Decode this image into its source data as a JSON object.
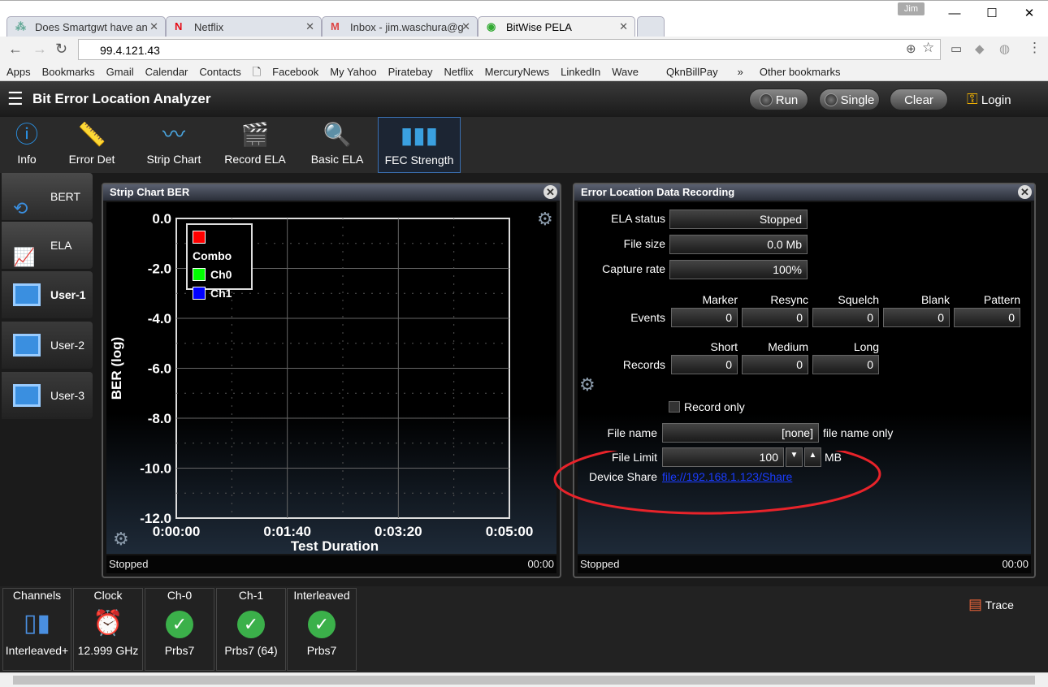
{
  "browser": {
    "tabs": [
      {
        "title": "Does Smartgwt have an",
        "icon": "smartgwt-icon"
      },
      {
        "title": "Netflix",
        "icon": "netflix-icon"
      },
      {
        "title": "Inbox - jim.waschura@g",
        "icon": "gmail-icon"
      },
      {
        "title": "BitWise PELA",
        "icon": "owl-icon",
        "active": true
      }
    ],
    "user": "Jim",
    "url": "99.4.121.43",
    "bookmarks": [
      "Apps",
      "Bookmarks",
      "Gmail",
      "Calendar",
      "Contacts",
      "",
      "Facebook",
      "My Yahoo",
      "Piratebay",
      "Netflix",
      "MercuryNews",
      "LinkedIn",
      "Wave",
      "QknBillPay",
      "»"
    ],
    "other_bookmarks": "Other bookmarks"
  },
  "app": {
    "title": "Bit Error Location Analyzer",
    "buttons": {
      "run": "Run",
      "single": "Single",
      "clear": "Clear",
      "login": "Login"
    },
    "toolbar": [
      {
        "label": "Info",
        "icon": "info-icon"
      },
      {
        "label": "Error Det",
        "icon": "ruler-icon"
      },
      {
        "label": "Strip Chart",
        "icon": "strip-chart-icon"
      },
      {
        "label": "Record ELA",
        "icon": "clapper-icon"
      },
      {
        "label": "Basic ELA",
        "icon": "document-search-icon"
      },
      {
        "label": "FEC Strength",
        "icon": "bar-chart-icon",
        "selected": true
      }
    ],
    "sidebar": [
      {
        "label": "BERT"
      },
      {
        "label": "ELA"
      },
      {
        "label": "User-1",
        "selected": true
      },
      {
        "label": "User-2"
      },
      {
        "label": "User-3"
      }
    ]
  },
  "strip_panel": {
    "title": "Strip Chart BER",
    "status": "Stopped",
    "time": "00:00",
    "chart": {
      "ylabel": "BER (log)",
      "xlabel": "Test Duration",
      "yticks": [
        "0.0",
        "-2.0",
        "-4.0",
        "-6.0",
        "-8.0",
        "-10.0",
        "-12.0"
      ],
      "xticks": [
        "0:00:00",
        "0:01:40",
        "0:03:20",
        "0:05:00"
      ],
      "ylim": [
        -12,
        0
      ],
      "legend": [
        {
          "name": "Combo",
          "color": "#ff0000"
        },
        {
          "name": "Ch0",
          "color": "#00ff00"
        },
        {
          "name": "Ch1",
          "color": "#0000ff"
        }
      ]
    }
  },
  "ela_panel": {
    "title": "Error Location Data Recording",
    "status": "Stopped",
    "time": "00:00",
    "ela_status_label": "ELA status",
    "ela_status": "Stopped",
    "file_size_label": "File size",
    "file_size": "0.0 Mb",
    "capture_rate_label": "Capture rate",
    "capture_rate": "100%",
    "events_label": "Events",
    "events": [
      {
        "name": "Marker",
        "value": "0"
      },
      {
        "name": "Resync",
        "value": "0"
      },
      {
        "name": "Squelch",
        "value": "0"
      },
      {
        "name": "Blank",
        "value": "0"
      },
      {
        "name": "Pattern",
        "value": "0"
      }
    ],
    "records_label": "Records",
    "records": [
      {
        "name": "Short",
        "value": "0"
      },
      {
        "name": "Medium",
        "value": "0"
      },
      {
        "name": "Long",
        "value": "0"
      }
    ],
    "record_only_label": "Record only",
    "record_only": false,
    "file_name_label": "File name",
    "file_name": "[none]",
    "file_name_hint": "file name only",
    "file_limit_label": "File Limit",
    "file_limit": "100",
    "file_limit_unit": "MB",
    "device_share_label": "Device Share",
    "device_share": "file://192.168.1.123/Share",
    "annotation_color": "#e8232a"
  },
  "status_bar": [
    {
      "title": "Channels",
      "value": "Interleaved+",
      "icon": "devices-icon"
    },
    {
      "title": "Clock",
      "value": "12.999 GHz",
      "icon": "alarm-clock-icon"
    },
    {
      "title": "Ch-0",
      "value": "Prbs7",
      "icon": "check-icon"
    },
    {
      "title": "Ch-1",
      "value": "Prbs7 (64)",
      "icon": "check-icon"
    },
    {
      "title": "Interleaved",
      "value": "Prbs7",
      "icon": "check-icon"
    }
  ],
  "trace_label": "Trace"
}
